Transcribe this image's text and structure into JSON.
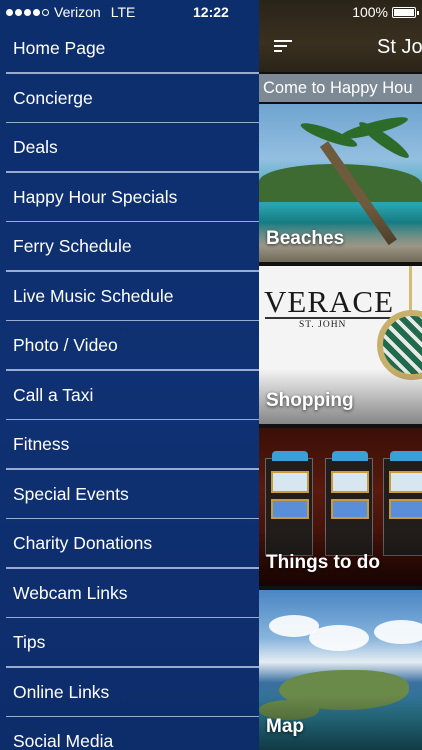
{
  "status": {
    "carrier": "Verizon",
    "network": "LTE",
    "time": "12:22",
    "battery": "100%"
  },
  "menu": {
    "items": [
      {
        "label": "Home Page"
      },
      {
        "label": "Concierge"
      },
      {
        "label": "Deals"
      },
      {
        "label": "Happy Hour Specials"
      },
      {
        "label": "Ferry Schedule"
      },
      {
        "label": "Live Music Schedule"
      },
      {
        "label": "Photo / Video"
      },
      {
        "label": "Call a Taxi"
      },
      {
        "label": "Fitness"
      },
      {
        "label": "Special Events"
      },
      {
        "label": "Charity Donations"
      },
      {
        "label": "Webcam Links"
      },
      {
        "label": "Tips"
      },
      {
        "label": "Online Links"
      },
      {
        "label": "Social Media"
      }
    ]
  },
  "content": {
    "title": "St Jo",
    "marquee": "Come to Happy Hou",
    "tiles": [
      {
        "label": "Beaches",
        "icon": "palm-beach-photo"
      },
      {
        "label": "Shopping",
        "icon": "jewelry-photo",
        "brand": "VERACE",
        "brand_sub": "ST. JOHN"
      },
      {
        "label": "Things to do",
        "icon": "slot-machines-photo"
      },
      {
        "label": "Map",
        "icon": "island-aerial-photo"
      }
    ]
  },
  "colors": {
    "drawer": "#0f3173",
    "divider": "#c8d7f0",
    "marquee_bg": "#7d8a96"
  }
}
